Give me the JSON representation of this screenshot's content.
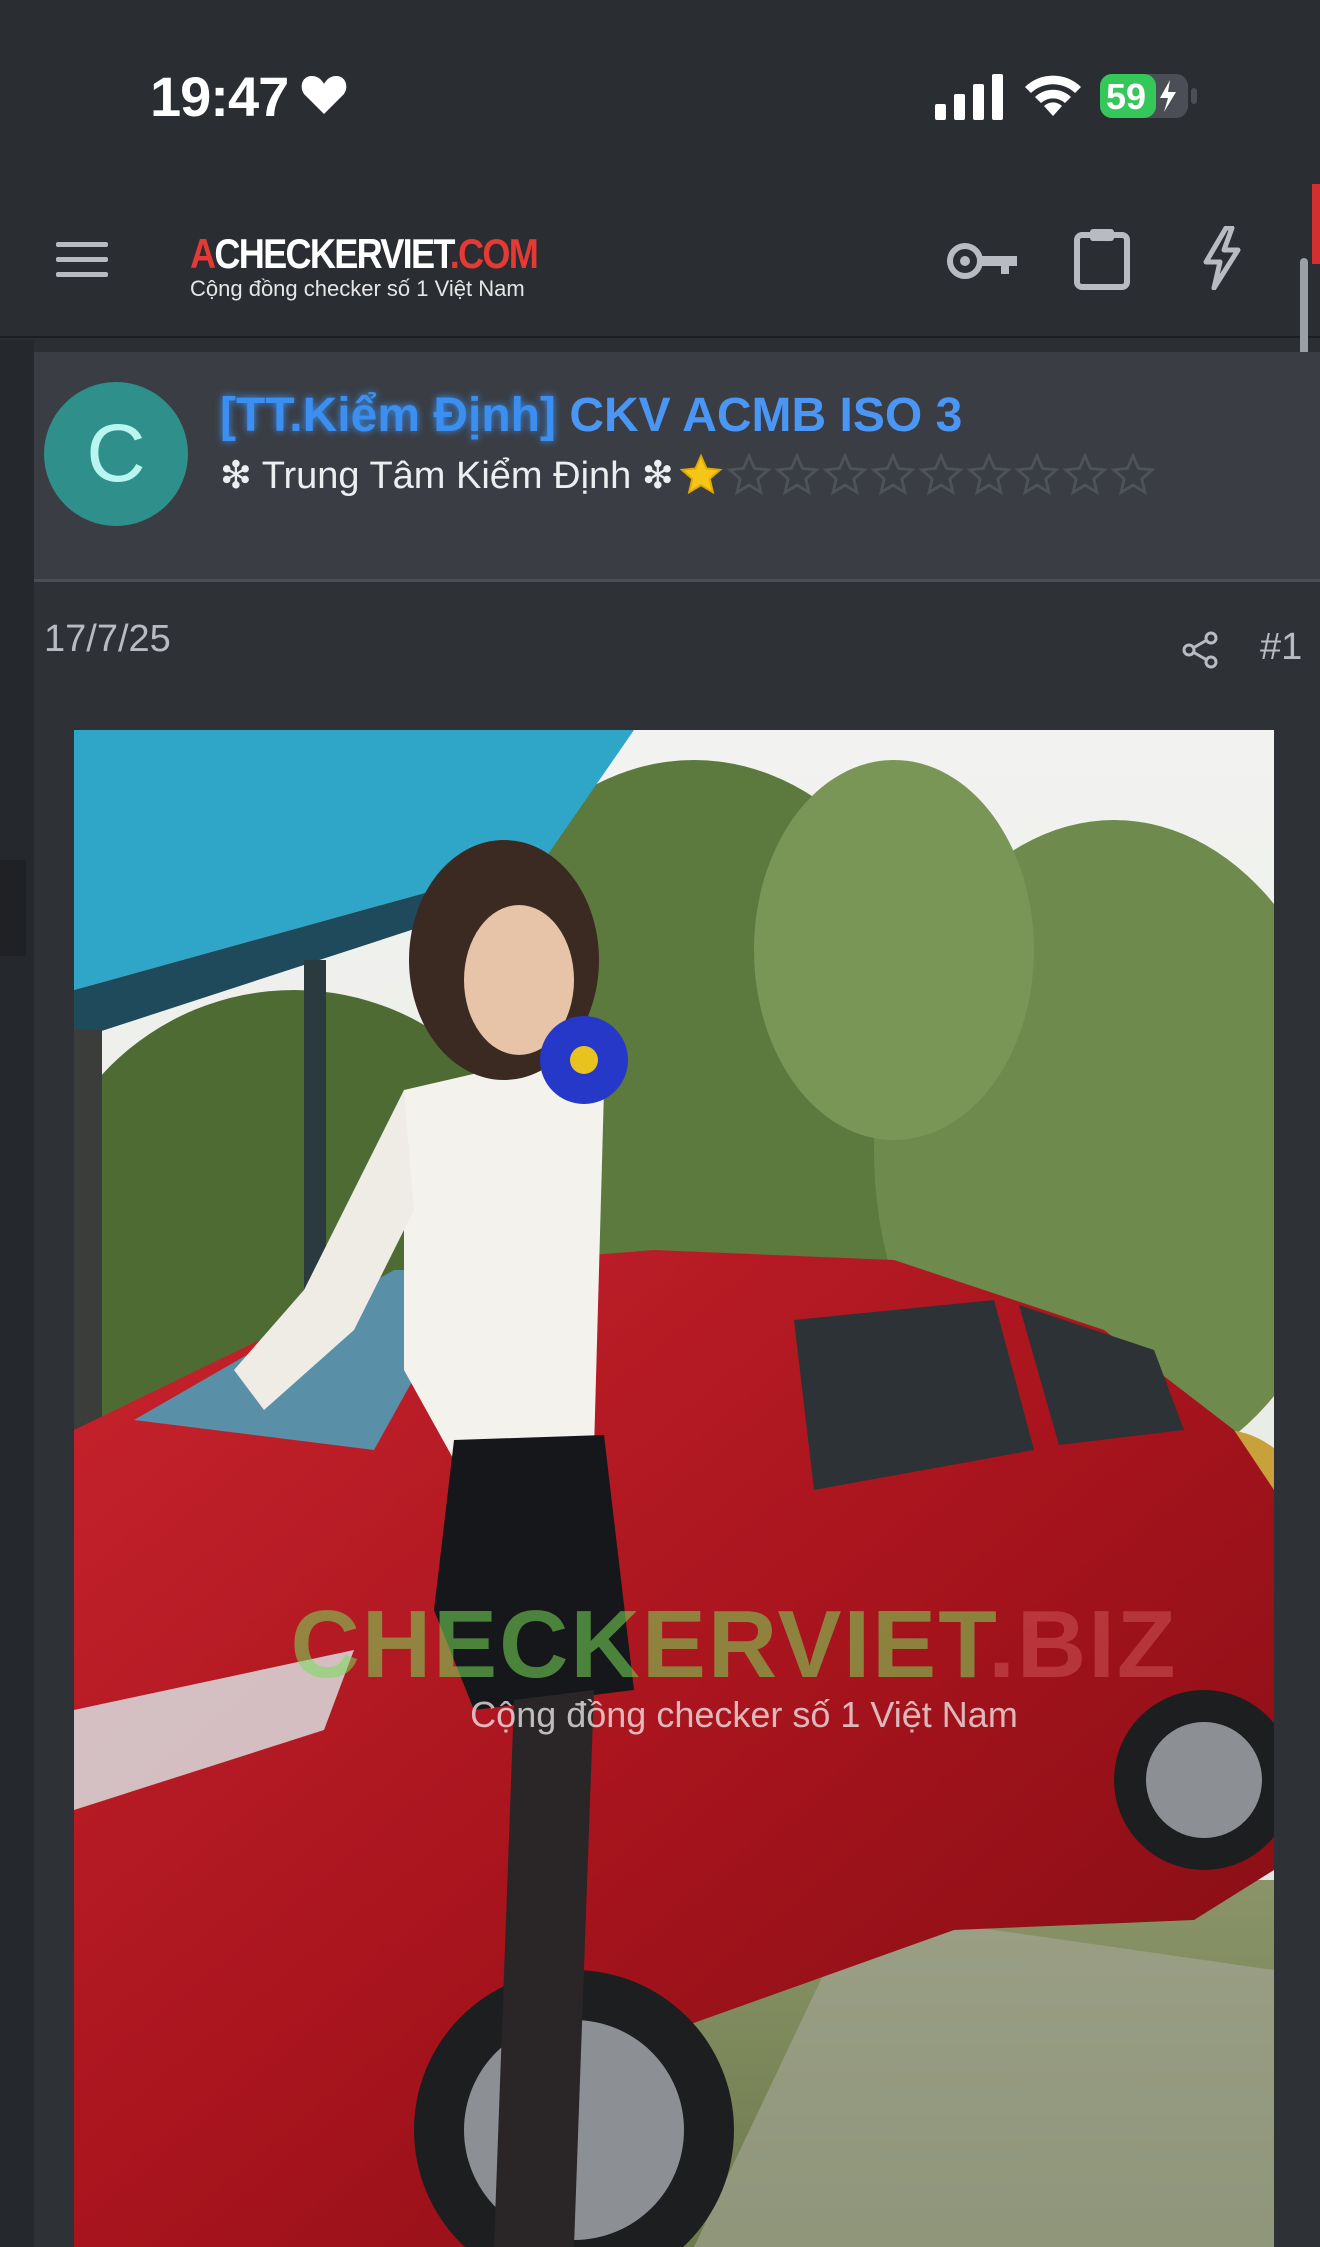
{
  "status_bar": {
    "time": "19:47",
    "battery": "59",
    "icons": [
      "heart-icon",
      "signal-icon",
      "wifi-icon",
      "battery-charging-icon"
    ]
  },
  "nav": {
    "logo_prefix": "A",
    "logo_main": "CHECKERVIET",
    "logo_suffix": ".COM",
    "logo_tagline": "Cộng đồng checker số 1 Việt Nam",
    "icons": [
      "menu-icon",
      "key-icon",
      "clipboard-icon",
      "bolt-icon"
    ],
    "accent_color": "#e53935"
  },
  "post": {
    "avatar_letter": "C",
    "avatar_color": "#2f8f8a",
    "user_tag": "[TT.Kiểm Định]",
    "user_name": "CKV ACMB ISO 3",
    "user_title": "❇ Trung Tâm Kiểm Định ❇",
    "stars_filled": 1,
    "stars_total": 10,
    "date": "17/7/25",
    "post_number": "#1",
    "name_color": "#4a96f5"
  },
  "image": {
    "watermark_main": "CHECKERVIET",
    "watermark_tail": ".BIZ",
    "watermark_sub": "Cộng đồng checker số 1 Việt Nam"
  }
}
